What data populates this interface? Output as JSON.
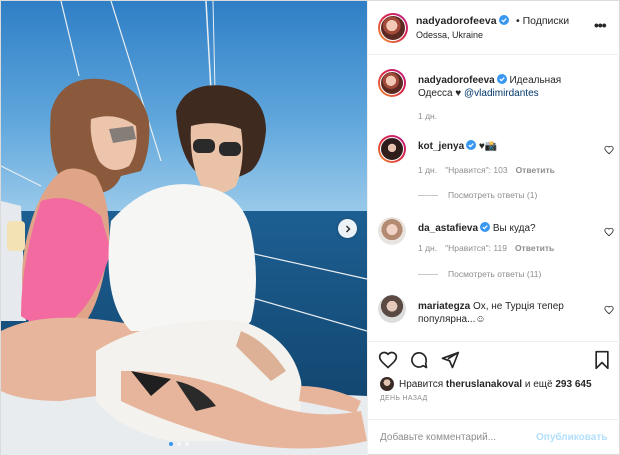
{
  "header": {
    "username": "nadyadorofeeva",
    "follow_label": "Подписки",
    "location": "Odessa, Ukraine",
    "more_icon": "ellipsis-icon"
  },
  "caption": {
    "username": "nadyadorofeeva",
    "text_1": "Идеальная",
    "text_2": "Одесса ♥",
    "mention": "@vladimirdantes",
    "time": "1 дн."
  },
  "comments": [
    {
      "username": "kot_jenya",
      "text": "♥📸",
      "time": "1 дн.",
      "likes": "\"Нравится\": 103",
      "reply_label": "Ответить",
      "view_replies": "Посмотреть ответы (1)"
    },
    {
      "username": "da_astafieva",
      "text": "Вы куда?",
      "time": "1 дн.",
      "likes": "\"Нравится\": 119",
      "reply_label": "Ответить",
      "view_replies": "Посмотреть ответы (11)"
    },
    {
      "username": "mariategza",
      "text_1": "Ох, не Турція тепер",
      "text_2": "популярна...☺"
    }
  ],
  "likes": {
    "prefix": "Нравится",
    "user": "theruslanakoval",
    "suffix": "и ещё",
    "count": "293 645"
  },
  "date": "ДЕНЬ НАЗАД",
  "add_comment": {
    "placeholder": "Добавьте комментарий...",
    "publish_label": "Опубликовать"
  },
  "colors": {
    "link": "#00376b",
    "muted": "#8e8e8e",
    "publish_disabled": "#b2dffc",
    "verified": "#3897f0"
  },
  "carousel": {
    "slides": 3,
    "active": 1
  }
}
